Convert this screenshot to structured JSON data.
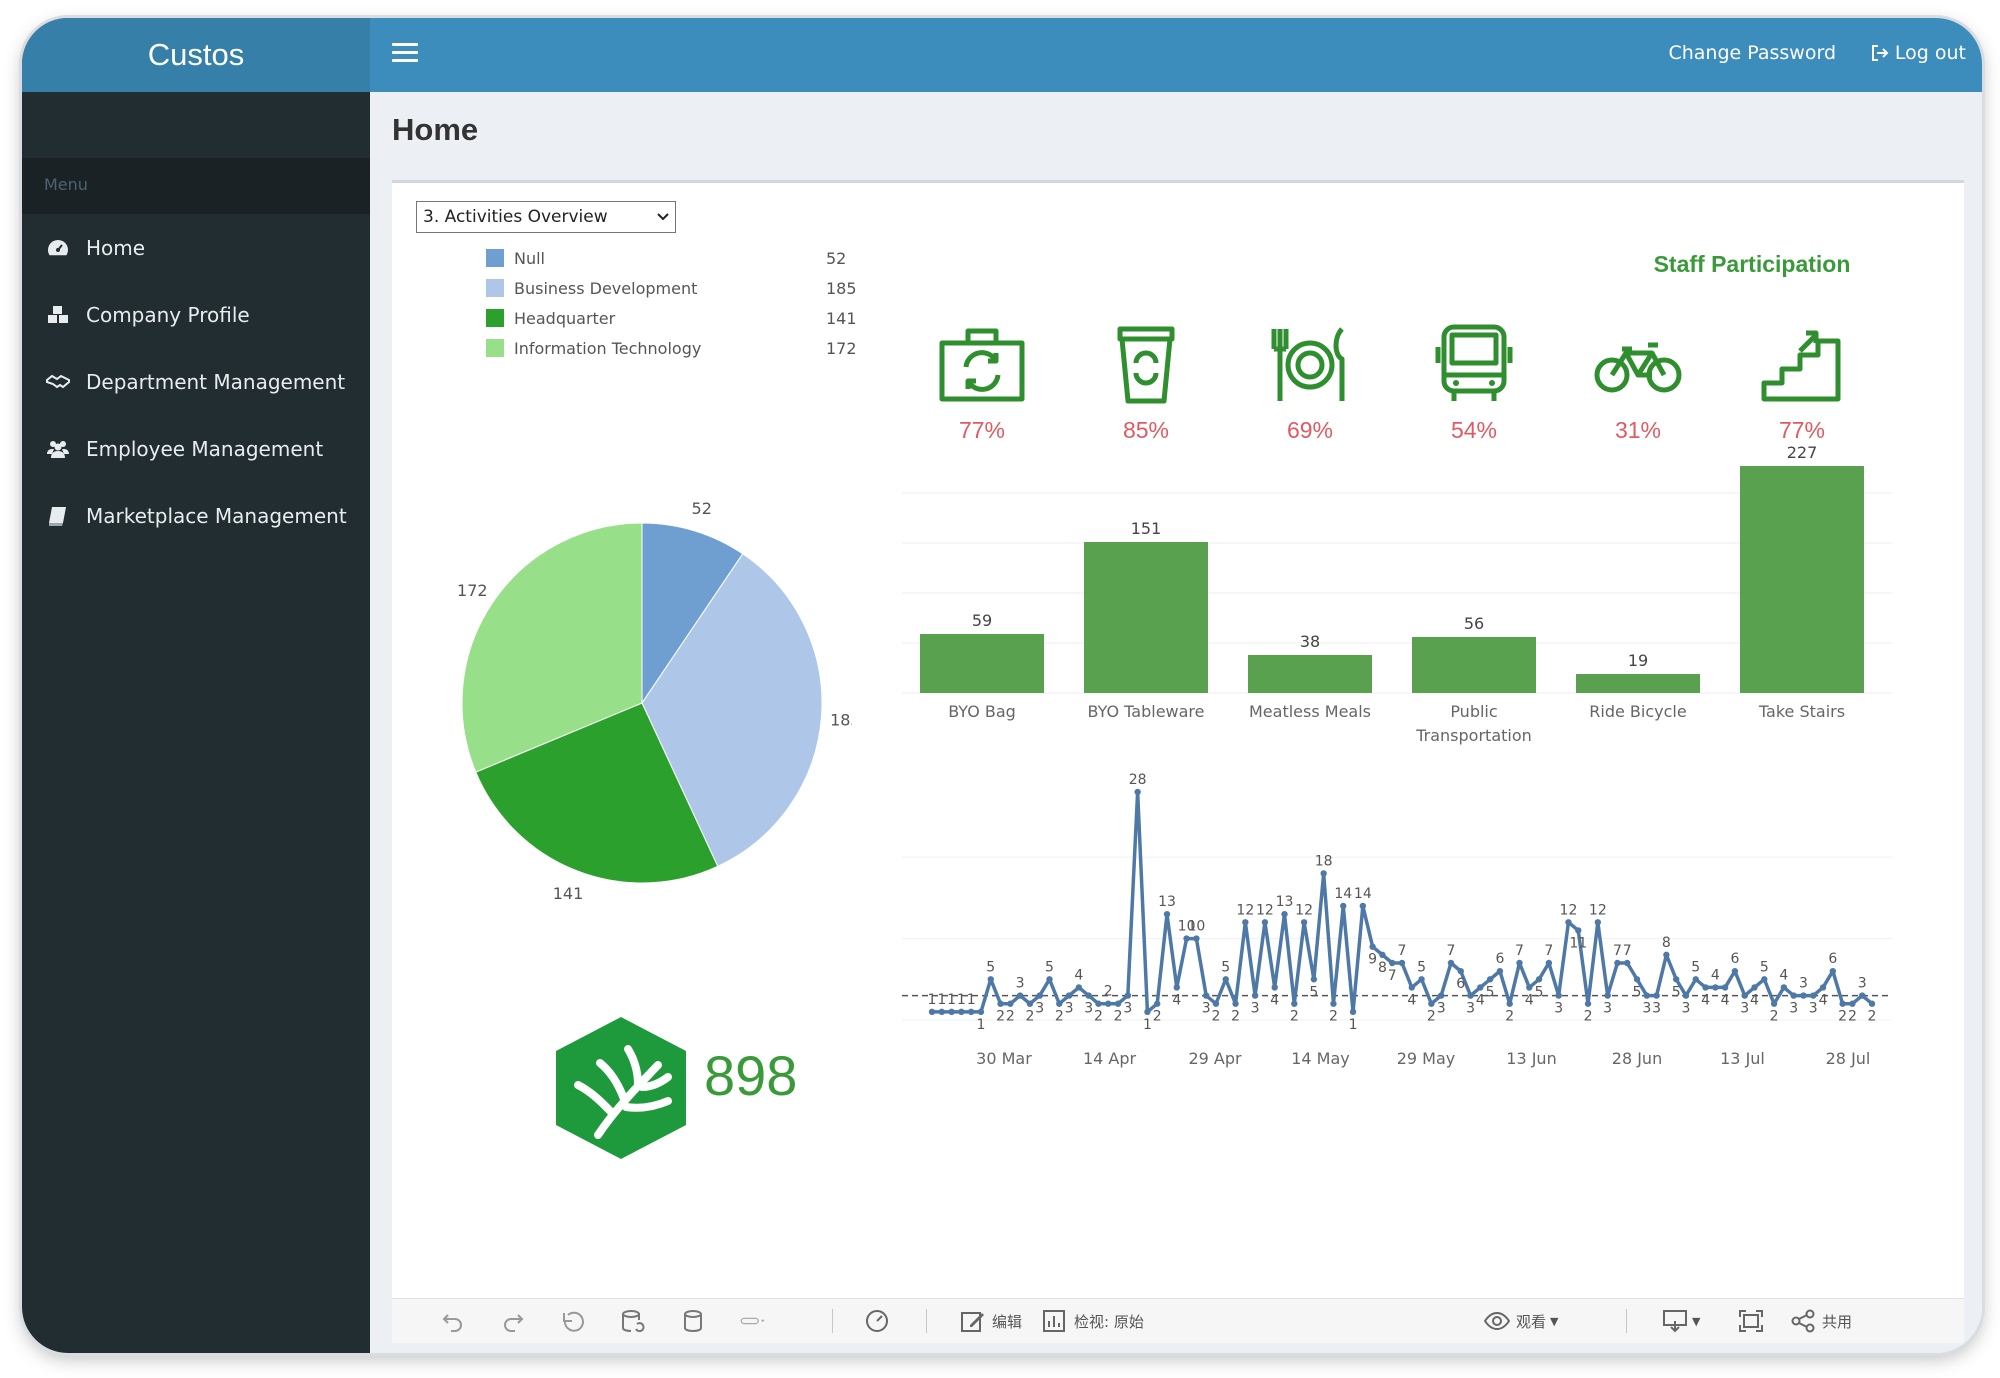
{
  "app": {
    "brand": "Custos"
  },
  "sidebar": {
    "menu_header": "Menu",
    "items": [
      {
        "label": "Home",
        "icon": "dashboard-icon"
      },
      {
        "label": "Company Profile",
        "icon": "cubes-icon"
      },
      {
        "label": "Department Management",
        "icon": "handshake-icon"
      },
      {
        "label": "Employee Management",
        "icon": "users-icon"
      },
      {
        "label": "Marketplace Management",
        "icon": "book-icon"
      }
    ]
  },
  "topbar": {
    "change_password": "Change Password",
    "logout": "Log out"
  },
  "page": {
    "title": "Home"
  },
  "filter": {
    "selected": "3. Activities Overview"
  },
  "legend": [
    {
      "label": "Null",
      "value": "52",
      "color": "#6f9fd1"
    },
    {
      "label": "Business Development",
      "value": "185",
      "color": "#aec7e8"
    },
    {
      "label": "Headquarter",
      "value": "141",
      "color": "#2ca02c"
    },
    {
      "label": "Information Technology",
      "value": "172",
      "color": "#98df8a"
    }
  ],
  "total": {
    "value": "898"
  },
  "staff_participation": {
    "title": "Staff Participation",
    "activities": [
      {
        "icon": "bag-icon",
        "pct": "77%"
      },
      {
        "icon": "cup-icon",
        "pct": "85%"
      },
      {
        "icon": "meal-icon",
        "pct": "69%"
      },
      {
        "icon": "bus-icon",
        "pct": "54%"
      },
      {
        "icon": "bicycle-icon",
        "pct": "31%"
      },
      {
        "icon": "stairs-icon",
        "pct": "77%"
      }
    ]
  },
  "toolbar": {
    "edit": "编辑",
    "view_original": "检视: 原始",
    "watch": "观看",
    "share": "共用"
  },
  "chart_data": [
    {
      "type": "pie",
      "categories": [
        "Null",
        "Business Development",
        "Headquarter",
        "Information Technology"
      ],
      "values": [
        52,
        185,
        141,
        172
      ],
      "colors": [
        "#6f9fd1",
        "#aec7e8",
        "#2ca02c",
        "#98df8a"
      ]
    },
    {
      "type": "bar",
      "categories": [
        "BYO Bag",
        "BYO Tableware",
        "Meatless Meals",
        "Public\nTransportation",
        "Ride Bicycle",
        "Take Stairs"
      ],
      "values": [
        59,
        151,
        38,
        56,
        19,
        227
      ],
      "ylim": [
        0,
        230
      ],
      "color": "#59a14f",
      "grid": true
    },
    {
      "type": "line",
      "x_tick_labels": [
        "30 Mar",
        "14 Apr",
        "29 Apr",
        "14 May",
        "29 May",
        "13 Jun",
        "28 Jun",
        "13 Jul",
        "28 Jul"
      ],
      "values": [
        1,
        1,
        1,
        1,
        1,
        1,
        5,
        2,
        2,
        3,
        2,
        3,
        5,
        2,
        3,
        4,
        3,
        2,
        2,
        2,
        3,
        28,
        1,
        2,
        13,
        4,
        10,
        10,
        3,
        2,
        5,
        2,
        12,
        3,
        12,
        4,
        13,
        2,
        12,
        5,
        18,
        2,
        14,
        1,
        14,
        9,
        8,
        7,
        7,
        4,
        5,
        2,
        3,
        7,
        6,
        3,
        4,
        5,
        6,
        2,
        7,
        4,
        5,
        7,
        3,
        12,
        11,
        2,
        12,
        3,
        7,
        7,
        5,
        3,
        3,
        8,
        5,
        3,
        5,
        4,
        4,
        4,
        6,
        3,
        4,
        5,
        2,
        4,
        3,
        3,
        3,
        4,
        6,
        2,
        2,
        3,
        2
      ],
      "ylim": [
        0,
        28
      ],
      "reference_line": 3,
      "color": "#4e79a7"
    }
  ]
}
